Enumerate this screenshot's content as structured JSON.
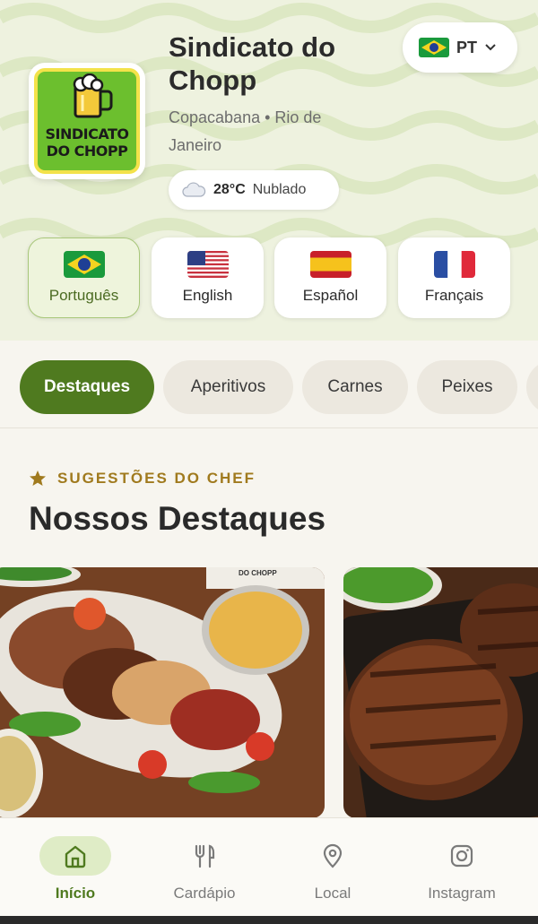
{
  "restaurant": {
    "name": "Sindicato do Chopp",
    "location": "Copacabana • Rio de Janeiro",
    "logo_text_line1": "SINDICATO",
    "logo_text_line2": "DO CHOPP"
  },
  "weather": {
    "temperature": "28°C",
    "condition": "Nublado",
    "icon": "cloud-icon"
  },
  "language_selector": {
    "current_code": "PT",
    "flag": "brazil-flag-icon"
  },
  "languages": [
    {
      "label": "Português",
      "flag": "brazil-flag-icon",
      "active": true
    },
    {
      "label": "English",
      "flag": "usa-flag-icon",
      "active": false
    },
    {
      "label": "Español",
      "flag": "spain-flag-icon",
      "active": false
    },
    {
      "label": "Français",
      "flag": "france-flag-icon",
      "active": false
    }
  ],
  "categories": [
    {
      "label": "Destaques",
      "active": true
    },
    {
      "label": "Aperitivos",
      "active": false
    },
    {
      "label": "Carnes",
      "active": false
    },
    {
      "label": "Peixes",
      "active": false
    }
  ],
  "section": {
    "kicker": "SUGESTÕES DO CHEF",
    "title": "Nossos Destaques"
  },
  "dish_images": [
    {
      "label": "DO CHOPP"
    }
  ],
  "bottom_nav": [
    {
      "label": "Início",
      "icon": "home-icon",
      "active": true
    },
    {
      "label": "Cardápio",
      "icon": "fork-knife-icon",
      "active": false
    },
    {
      "label": "Local",
      "icon": "location-pin-icon",
      "active": false
    },
    {
      "label": "Instagram",
      "icon": "instagram-icon",
      "active": false
    }
  ],
  "colors": {
    "brand_green": "#4f7a1f",
    "accent_gold": "#a07a1e",
    "logo_green": "#6cbf2e",
    "logo_yellow": "#f3e24a"
  }
}
